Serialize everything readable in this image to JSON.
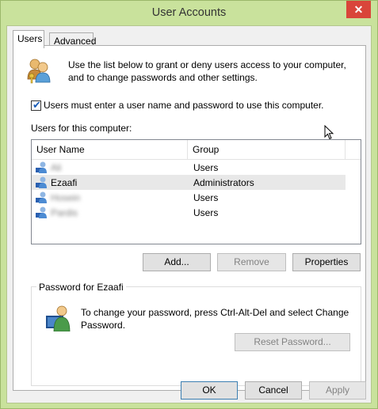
{
  "window": {
    "title": "User Accounts",
    "close_label": "✕"
  },
  "tabs": [
    {
      "label": "Users",
      "active": true
    },
    {
      "label": "Advanced",
      "active": false
    }
  ],
  "intro": {
    "icon": "users-group-icon",
    "text": "Use the list below to grant or deny users access to your computer, and to change passwords and other settings."
  },
  "checkbox": {
    "checked": true,
    "label": "Users must enter a user name and password to use this computer."
  },
  "users_section": {
    "label": "Users for this computer:",
    "columns": [
      "User Name",
      "Group"
    ],
    "rows": [
      {
        "name": "Ali",
        "group": "Users",
        "blurred": true,
        "selected": false
      },
      {
        "name": "Ezaafi",
        "group": "Administrators",
        "blurred": false,
        "selected": true
      },
      {
        "name": "Hosein",
        "group": "Users",
        "blurred": true,
        "selected": false
      },
      {
        "name": "Pardis",
        "group": "Users",
        "blurred": true,
        "selected": false
      }
    ]
  },
  "list_buttons": {
    "add": "Add...",
    "remove": "Remove",
    "properties": "Properties"
  },
  "password_group": {
    "title": "Password for Ezaafi",
    "text": "To change your password, press Ctrl-Alt-Del and select Change Password.",
    "reset": "Reset Password..."
  },
  "footer": {
    "ok": "OK",
    "cancel": "Cancel",
    "apply": "Apply"
  }
}
